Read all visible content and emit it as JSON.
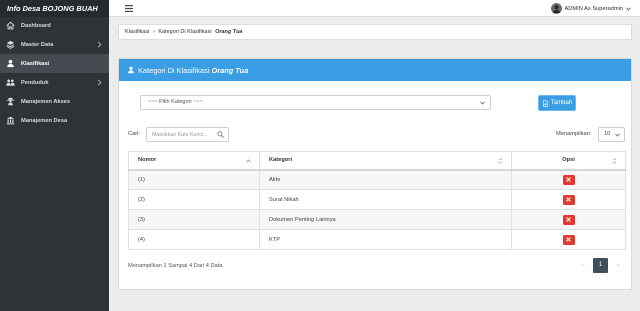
{
  "brand": "Info Desa BOJONG BUAH",
  "colors": {
    "sidebar_bg": "#2e3338",
    "brand_bg": "#262b30",
    "accent": "#3a9ee4",
    "danger": "#e0392f",
    "pager_active": "#3f4f5c"
  },
  "sidebar": {
    "items": [
      {
        "label": "Dashboard",
        "icon": "home-icon"
      },
      {
        "label": "Master Data",
        "icon": "layers-icon",
        "has_submenu": true
      },
      {
        "label": "Klasifikasi",
        "icon": "user-icon",
        "active": true
      },
      {
        "label": "Penduduk",
        "icon": "users-icon",
        "has_submenu": true
      },
      {
        "label": "Manajemen Akses",
        "icon": "user-secret-icon"
      },
      {
        "label": "Manajemen Desa",
        "icon": "bank-icon"
      }
    ]
  },
  "topbar": {
    "menu_icon": "hamburger-icon",
    "user_name": "ADMIN As Superadmin",
    "caret_icon": "chevron-down-icon"
  },
  "breadcrumb": {
    "parent": "Klasifikasi",
    "separator": "›",
    "current": "Kategori Di Klasifikasi",
    "current_emphasis": "Orang Tua"
  },
  "panel": {
    "icon": "user-icon",
    "title": "Kategori Di Klasifikasi",
    "title_emphasis": "Orang Tua"
  },
  "form": {
    "category_select": {
      "value": "~~~ Pilih Kategori ~~~",
      "icon": "chevron-down-icon"
    },
    "add_button": {
      "label": "Tambah",
      "icon": "file-plus-icon"
    }
  },
  "search": {
    "label": "Cari:",
    "placeholder": "Masukkan Kata Kunci...",
    "icon": "search-icon"
  },
  "page_size": {
    "label": "Menampilkan:",
    "value": "10"
  },
  "table": {
    "columns": [
      "Nomor",
      "Kategori",
      "Opsi"
    ],
    "sort": {
      "Nomor": "asc",
      "Kategori": "none",
      "Opsi": "none"
    },
    "action_icon": "delete-icon",
    "rows": [
      {
        "nomor": "(1)",
        "kategori": "Akte"
      },
      {
        "nomor": "(2)",
        "kategori": "Surat Nikah"
      },
      {
        "nomor": "(3)",
        "kategori": "Dokumen Penting Lainnya"
      },
      {
        "nomor": "(4)",
        "kategori": "KTP"
      }
    ]
  },
  "footer": {
    "summary": "Menampilkan 1 Sampai 4 Dari 4 Data"
  },
  "pagination": {
    "prev": "←",
    "current_page": "1",
    "next": "→"
  }
}
